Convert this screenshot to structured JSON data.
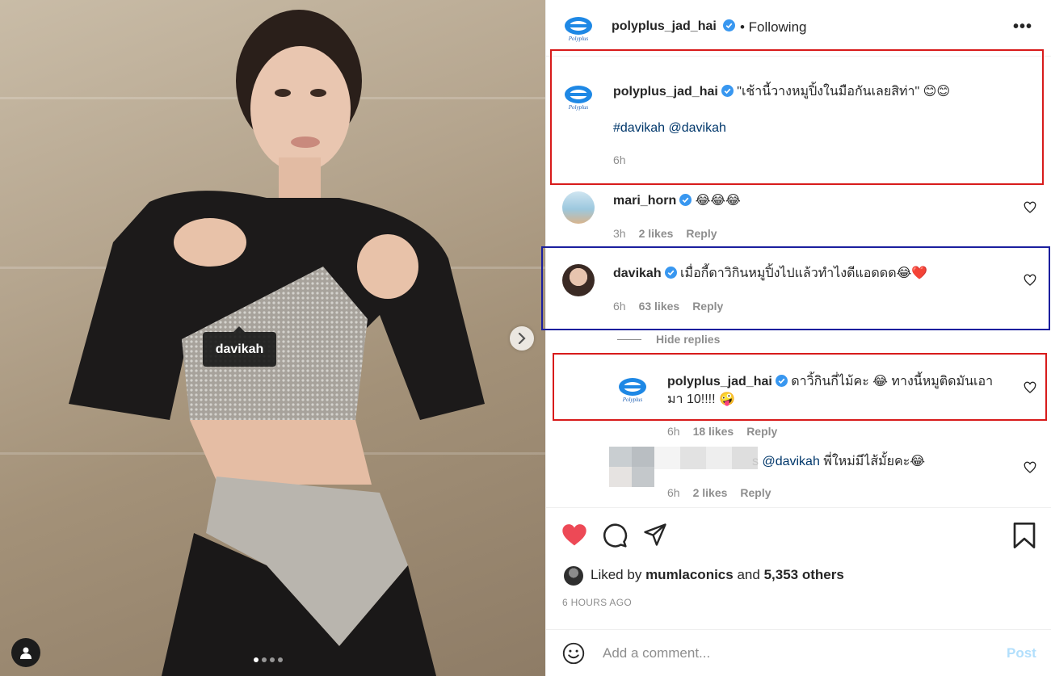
{
  "photo": {
    "tag_label": "davikah",
    "carousel_dot_count": 4,
    "carousel_active_index": 0
  },
  "header": {
    "username": "polyplus_jad_hai",
    "follow_status": "• Following",
    "more_label": "•••"
  },
  "caption": {
    "username": "polyplus_jad_hai",
    "text": "\"เช้านี้วางหมูปิ้งในมือกันเลยสิท่า\" 😊😊",
    "tags": "#davikah @davikah",
    "time": "6h"
  },
  "comments": [
    {
      "username": "mari_horn",
      "text": "😂😂😂",
      "time": "3h",
      "likes": "2 likes",
      "reply": "Reply"
    },
    {
      "username": "davikah",
      "text": "เมื่อกี้ดาวิกินหมูปิ้งไปแล้วทำไงดีแอดดด😂❤️",
      "time": "6h",
      "likes": "63 likes",
      "reply": "Reply"
    }
  ],
  "hide_replies": "Hide replies",
  "replies": [
    {
      "username": "polyplus_jad_hai",
      "text_line1": "ดาวิ้กินกี่ไม้คะ 😂 ทางนี้หมูติดมันเอา",
      "text_line2": "มา 10!!!! 🤪",
      "time": "6h",
      "likes": "18 likes",
      "reply": "Reply"
    },
    {
      "partial_name": "s",
      "mention": "@davikah",
      "text": "พี่ใหม่มีไส้มั้ยคะ😂",
      "time": "6h",
      "likes": "2 likes",
      "reply": "Reply"
    }
  ],
  "likes": {
    "prefix": "Liked by",
    "user": "mumlaconics",
    "middle": "and",
    "others": "5,353 others"
  },
  "timestamp": "6 HOURS AGO",
  "add_comment": {
    "placeholder": "Add a comment...",
    "post_label": "Post"
  },
  "colors": {
    "like_red": "#ed4956",
    "verified_blue": "#3897f0",
    "highlight_red": "#d81b1b",
    "highlight_blue": "#1b1f9e",
    "post_disabled": "#b2dffc"
  }
}
